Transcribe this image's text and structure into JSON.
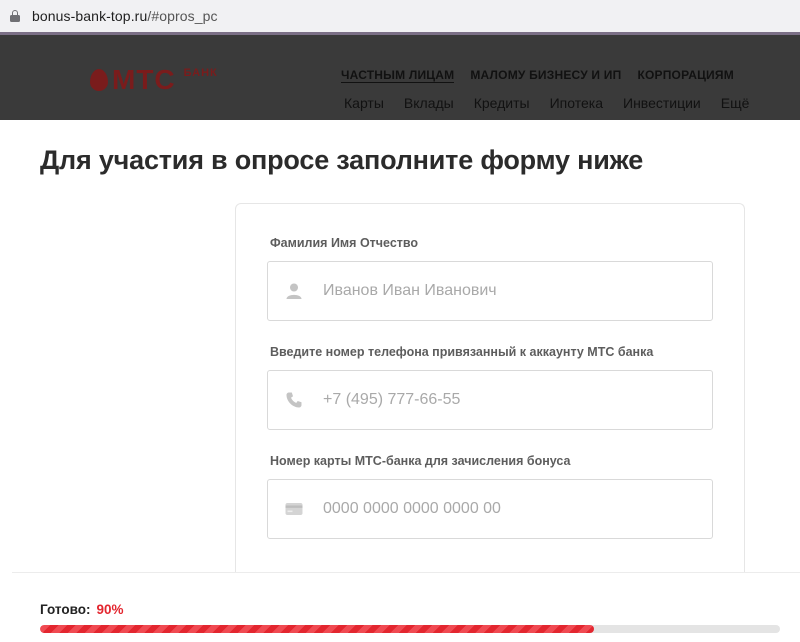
{
  "browser": {
    "url_host": "bonus-bank-top.ru",
    "url_rest": "/#opros_pc"
  },
  "header": {
    "logo_text": "МТС",
    "logo_sub": "БАНК",
    "segments": [
      "ЧАСТНЫМ ЛИЦАМ",
      "МАЛОМУ БИЗНЕСУ И ИП",
      "КОРПОРАЦИЯМ"
    ],
    "products": [
      "Карты",
      "Вклады",
      "Кредиты",
      "Ипотека",
      "Инвестиции",
      "Ещё"
    ]
  },
  "form": {
    "title": "Для участия в опросе заполните форму ниже",
    "fields": [
      {
        "label": "Фамилия Имя Отчество",
        "placeholder": "Иванов Иван Иванович",
        "icon": "user-icon"
      },
      {
        "label": "Введите номер телефона привязанный к аккаунту МТС банка",
        "placeholder": "+7 (495) 777-66-55",
        "icon": "phone-icon"
      },
      {
        "label": "Номер карты МТС-банка для зачисления бонуса",
        "placeholder": "0000 0000 0000 0000 00",
        "icon": "card-icon"
      }
    ]
  },
  "progress": {
    "label": "Готово:",
    "value_text": "90%",
    "fraction": 0.748
  },
  "colors": {
    "accent": "#e3262f",
    "logo_dimmed": "#7a1c1c",
    "header_dimmed": "#3a3a3a"
  }
}
